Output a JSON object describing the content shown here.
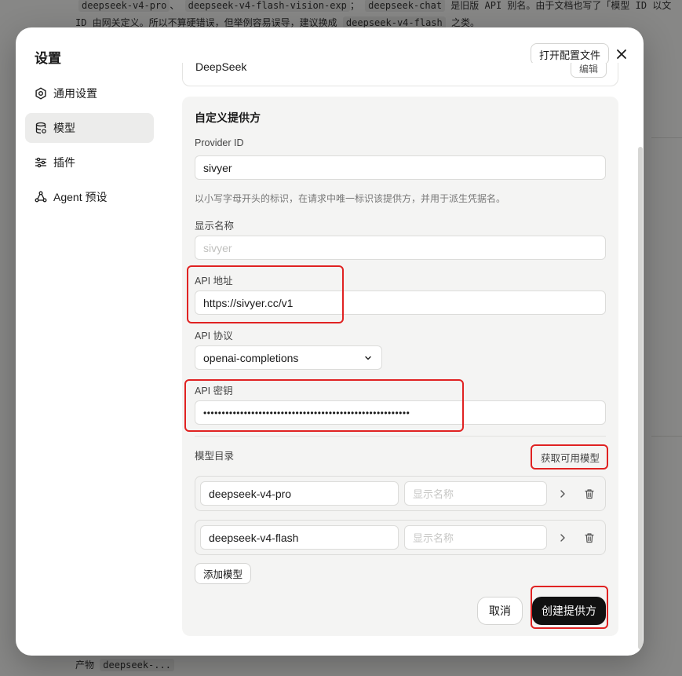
{
  "background": {
    "top_line_1_code_a": "deepseek-v4-pro",
    "top_line_1_code_b": "deepseek-v4-flash-vision-exp",
    "top_line_1_code_c": "deepseek-chat",
    "top_line_1_text": "是旧版 API 别名。由于文档也写了「模型 ID 以文",
    "top_line_2_text": "ID 由网关定义。所以不算硬错误，但举例容易误导，建议换成",
    "top_line_2_code": "deepseek-v4-flash",
    "top_line_2_tail": "之类。",
    "bottom_label": "产物",
    "bottom_code": "deepseek-..."
  },
  "dialog": {
    "title": "设置",
    "open_config_label": "打开配置文件"
  },
  "sidebar": {
    "items": [
      {
        "label": "通用设置",
        "icon": "gear-icon"
      },
      {
        "label": "模型",
        "icon": "database-icon"
      },
      {
        "label": "插件",
        "icon": "sliders-icon"
      },
      {
        "label": "Agent 预设",
        "icon": "agent-icon"
      }
    ]
  },
  "previous_provider": {
    "name": "DeepSeek",
    "button": "编辑"
  },
  "custom_provider": {
    "section_title": "自定义提供方",
    "provider_id_label": "Provider ID",
    "provider_id_value": "sivyer",
    "provider_id_helper": "以小写字母开头的标识，在请求中唯一标识该提供方，并用于派生凭据名。",
    "display_name_label": "显示名称",
    "display_name_placeholder": "sivyer",
    "api_url_label": "API 地址",
    "api_url_value": "https://sivyer.cc/v1",
    "api_protocol_label": "API 协议",
    "api_protocol_value": "openai-completions",
    "api_key_label": "API 密钥",
    "api_key_value": "••••••••••••••••••••••••••••••••••••••••••••••••••••••••",
    "model_catalog_label": "模型目录",
    "fetch_models_label": "获取可用模型",
    "models": [
      {
        "id": "deepseek-v4-pro",
        "display_placeholder": "显示名称"
      },
      {
        "id": "deepseek-v4-flash",
        "display_placeholder": "显示名称"
      }
    ],
    "add_model_label": "添加模型",
    "cancel_label": "取消",
    "create_label": "创建提供方"
  },
  "colors": {
    "annotation": "#e02222",
    "primary_button": "#111111",
    "card_bg": "#f4f4f3"
  }
}
